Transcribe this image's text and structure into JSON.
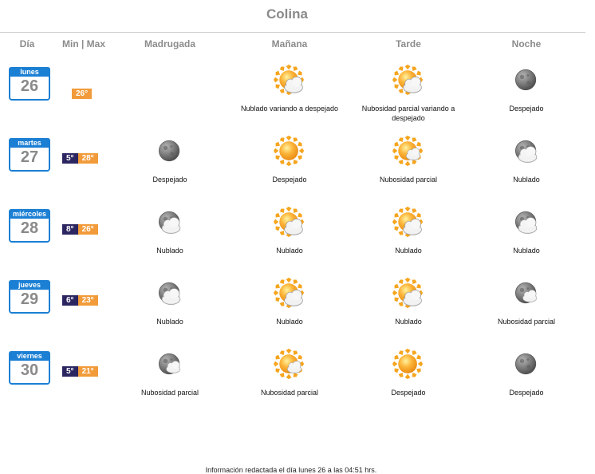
{
  "title": "Colina",
  "headers": {
    "day": "Día",
    "minmax": "Min | Max",
    "madrugada": "Madrugada",
    "manana": "Mañana",
    "tarde": "Tarde",
    "noche": "Noche"
  },
  "days": [
    {
      "weekday": "lunes",
      "date": "26",
      "min": "",
      "max": "26°",
      "madrugada": null,
      "manana": {
        "icon": "sun-cloud-icon",
        "desc": "Nublado variando a despejado"
      },
      "tarde": {
        "icon": "sun-cloud-icon",
        "desc": "Nubosidad parcial variando a despejado"
      },
      "noche": {
        "icon": "moon-icon",
        "desc": "Despejado"
      }
    },
    {
      "weekday": "martes",
      "date": "27",
      "min": "5°",
      "max": "28°",
      "madrugada": {
        "icon": "moon-icon",
        "desc": "Despejado"
      },
      "manana": {
        "icon": "sun-icon",
        "desc": "Despejado"
      },
      "tarde": {
        "icon": "sun-small-cloud-icon",
        "desc": "Nubosidad parcial"
      },
      "noche": {
        "icon": "moon-cloud-icon",
        "desc": "Nublado"
      }
    },
    {
      "weekday": "miércoles",
      "date": "28",
      "min": "8°",
      "max": "26°",
      "madrugada": {
        "icon": "moon-cloud-icon",
        "desc": "Nublado"
      },
      "manana": {
        "icon": "sun-cloud-icon",
        "desc": "Nublado"
      },
      "tarde": {
        "icon": "sun-cloud-icon",
        "desc": "Nublado"
      },
      "noche": {
        "icon": "moon-cloud-icon",
        "desc": "Nublado"
      }
    },
    {
      "weekday": "jueves",
      "date": "29",
      "min": "6°",
      "max": "23°",
      "madrugada": {
        "icon": "moon-cloud-icon",
        "desc": "Nublado"
      },
      "manana": {
        "icon": "sun-cloud-icon",
        "desc": "Nublado"
      },
      "tarde": {
        "icon": "sun-cloud-icon",
        "desc": "Nublado"
      },
      "noche": {
        "icon": "moon-small-cloud-icon",
        "desc": "Nubosidad parcial"
      }
    },
    {
      "weekday": "viernes",
      "date": "30",
      "min": "5°",
      "max": "21°",
      "madrugada": {
        "icon": "moon-small-cloud-icon",
        "desc": "Nubosidad parcial"
      },
      "manana": {
        "icon": "sun-small-cloud-icon",
        "desc": "Nubosidad parcial"
      },
      "tarde": {
        "icon": "sun-icon",
        "desc": "Despejado"
      },
      "noche": {
        "icon": "moon-icon",
        "desc": "Despejado"
      }
    }
  ],
  "footer": "Información redactada el día lunes 26 a las 04:51 hrs."
}
